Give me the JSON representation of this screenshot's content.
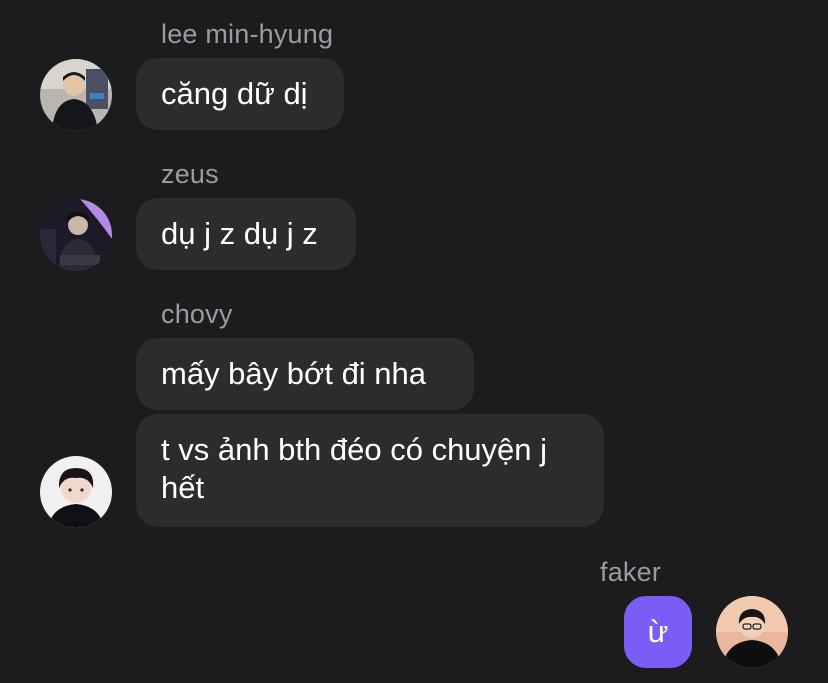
{
  "messages": [
    {
      "sender": "lee min-hyung",
      "text": "căng dữ dị",
      "avatar": "avatar-lee-min-hyung"
    },
    {
      "sender": "zeus",
      "text": "dụ j z dụ j z",
      "avatar": "avatar-zeus"
    },
    {
      "sender": "chovy",
      "text": "mấy bây bớt đi nha",
      "avatar": null
    },
    {
      "sender": "chovy",
      "text": "t vs ảnh bth đéo có chuyện j hết",
      "avatar": "avatar-chovy"
    },
    {
      "sender": "faker",
      "text": "ừ",
      "avatar": "avatar-faker",
      "outgoing": true
    }
  ],
  "colors": {
    "background": "#1c1c1e",
    "incoming_bubble": "#2c2c2e",
    "outgoing_bubble": "#7b5cf5",
    "sender_name": "#9a9aa0",
    "message_text": "#ffffff"
  }
}
